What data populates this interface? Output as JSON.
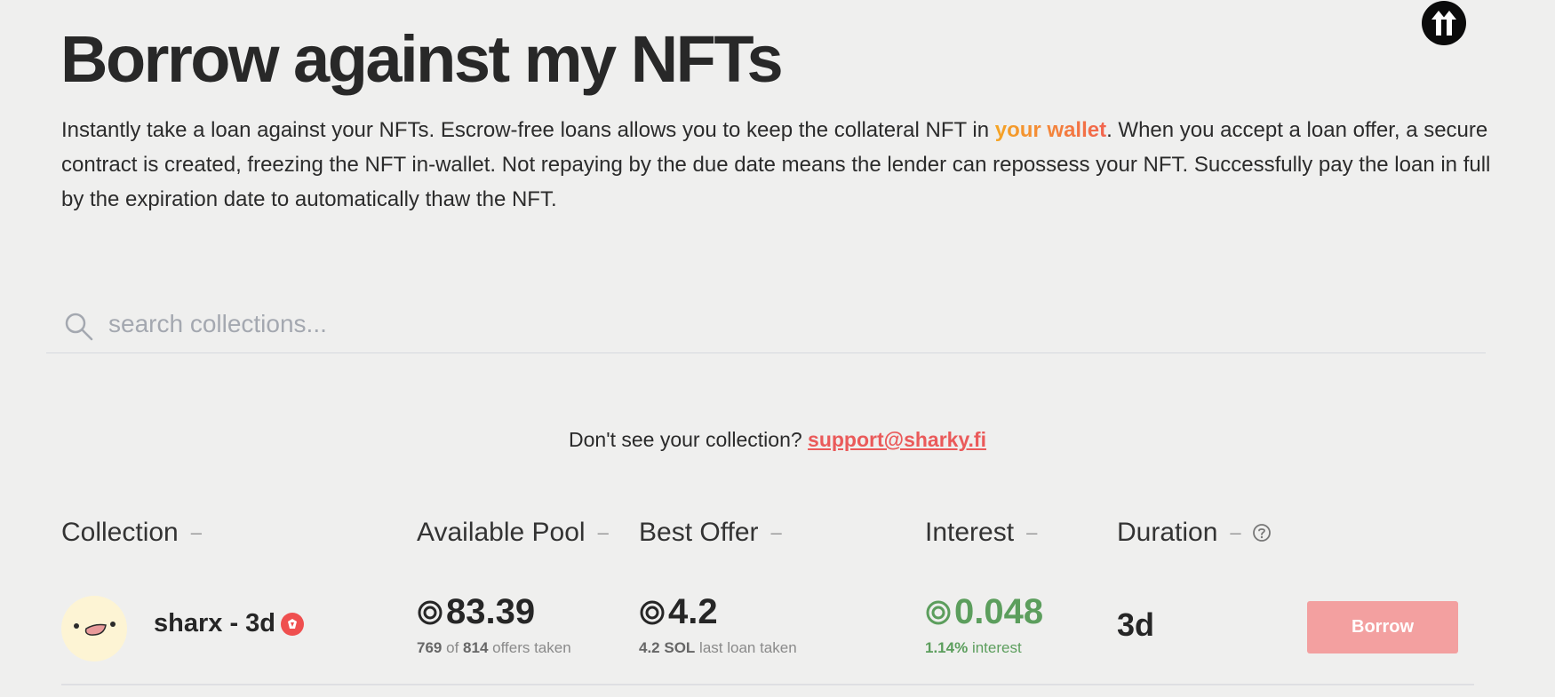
{
  "page": {
    "title": "Borrow against my NFTs",
    "intro_before": "Instantly take a loan against your NFTs. Escrow-free loans allows you to keep the collateral NFT in ",
    "intro_highlight": "your wallet",
    "intro_after": ". When you accept a loan offer, a secure contract is created, freezing the NFT in-wallet. Not repaying by the due date means the lender can repossess your NFT. Successfully pay the loan in full by the expiration date to automatically thaw the NFT."
  },
  "search": {
    "placeholder": "search collections...",
    "value": ""
  },
  "support": {
    "text": "Don't see your collection? ",
    "email": "support@sharky.fi"
  },
  "table": {
    "headers": {
      "collection": "Collection",
      "available_pool": "Available Pool",
      "best_offer": "Best Offer",
      "interest": "Interest",
      "duration": "Duration",
      "sort_indicator": "–"
    },
    "rows": [
      {
        "name": "sharx - 3d",
        "pool": "83.39",
        "offers_taken": "769",
        "of_label": "of",
        "offers_total": "814",
        "offers_suffix": "offers taken",
        "best_offer": "4.2",
        "last_loan": "4.2 SOL",
        "last_loan_suffix": "last loan taken",
        "interest": "0.048",
        "interest_pct": "1.14%",
        "interest_suffix": "interest",
        "duration": "3d",
        "action_label": "Borrow"
      }
    ]
  },
  "colors": {
    "accent_gradient": [
      "#f5a524",
      "#f2644f"
    ],
    "link": "#ea5a5a",
    "interest_green": "#5c9e5d",
    "borrow_button": "#f3a0a0",
    "badge_red": "#ef4f4f"
  },
  "icons": {
    "scroll_top": "arrows-up-icon",
    "search": "search-icon",
    "sol": "sol-coin-icon",
    "badge": "verified-badge-icon",
    "help": "question-circle-icon"
  }
}
